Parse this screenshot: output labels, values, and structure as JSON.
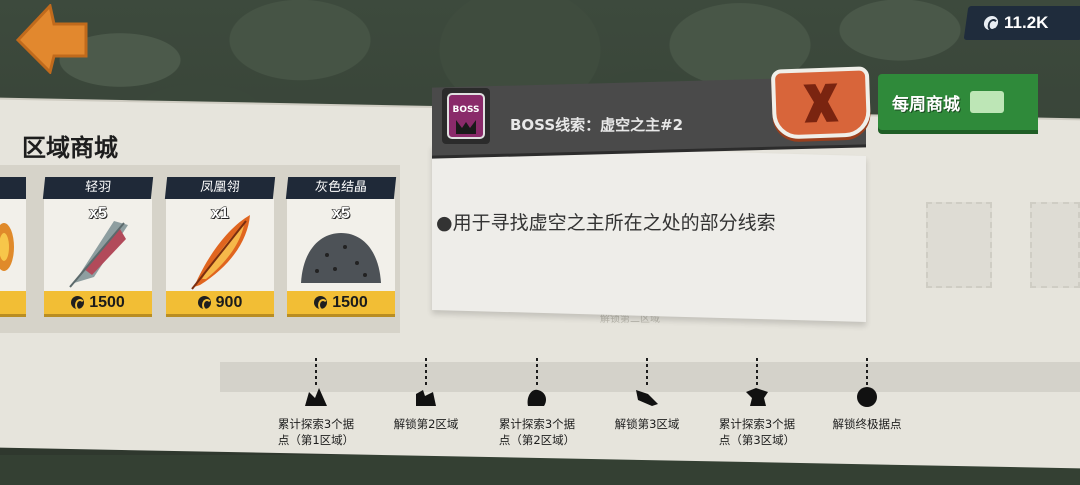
{
  "currency": {
    "amount": "11.2K",
    "icon": "coin-icon"
  },
  "shop": {
    "title": "区域商城",
    "items": [
      {
        "name": "轻羽",
        "qty": "x5",
        "price": "1500",
        "icon": "feather-icon"
      },
      {
        "name": "凤凰翎",
        "qty": "x1",
        "price": "900",
        "icon": "phoenix-feather-icon"
      },
      {
        "name": "灰色结晶",
        "qty": "x5",
        "price": "1500",
        "icon": "gray-crystal-icon"
      }
    ]
  },
  "weekly_shop": {
    "label": "每周商城",
    "icon": "shop-icon"
  },
  "popup": {
    "title": "BOSS线索：虚空之主#2",
    "badge": "BOSS",
    "description": "●用于寻找虚空之主所在之处的部分线索"
  },
  "track": {
    "faded_label": "解锁第二区域"
  },
  "milestones": [
    {
      "label_line1": "累计探索3个据",
      "label_line2": "点（第1区域）"
    },
    {
      "label_line1": "解锁第2区域",
      "label_line2": ""
    },
    {
      "label_line1": "累计探索3个据",
      "label_line2": "点（第2区域）"
    },
    {
      "label_line1": "解锁第3区域",
      "label_line2": ""
    },
    {
      "label_line1": "累计探索3个据",
      "label_line2": "点（第3区域）"
    },
    {
      "label_line1": "解锁终极据点",
      "label_line2": ""
    }
  ],
  "colors": {
    "accent_green": "#2f8a3a",
    "price_yellow": "#f2be35",
    "close_orange": "#d8653a",
    "back_orange": "#e2882e"
  }
}
